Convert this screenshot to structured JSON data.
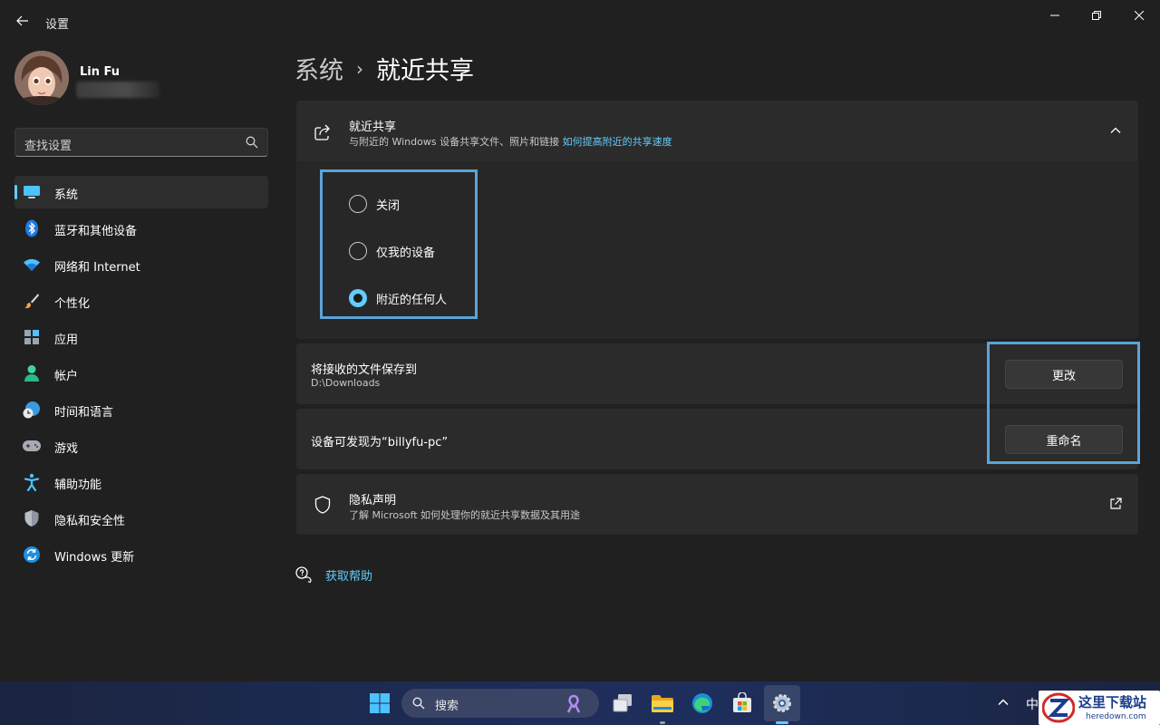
{
  "window": {
    "title": "设置"
  },
  "profile": {
    "name": "Lin Fu"
  },
  "search": {
    "placeholder": "查找设置"
  },
  "sidebar": {
    "items": [
      {
        "label": "系统",
        "icon": "monitor-icon",
        "active": true
      },
      {
        "label": "蓝牙和其他设备",
        "icon": "bluetooth-icon"
      },
      {
        "label": "网络和 Internet",
        "icon": "wifi-icon"
      },
      {
        "label": "个性化",
        "icon": "brush-icon"
      },
      {
        "label": "应用",
        "icon": "apps-icon"
      },
      {
        "label": "帐户",
        "icon": "person-icon"
      },
      {
        "label": "时间和语言",
        "icon": "globe-clock-icon"
      },
      {
        "label": "游戏",
        "icon": "gamepad-icon"
      },
      {
        "label": "辅助功能",
        "icon": "accessibility-icon"
      },
      {
        "label": "隐私和安全性",
        "icon": "shield-icon"
      },
      {
        "label": "Windows 更新",
        "icon": "update-icon"
      }
    ]
  },
  "breadcrumb": {
    "parent": "系统",
    "separator": "›",
    "current": "就近共享"
  },
  "nearby_sharing": {
    "title": "就近共享",
    "subtitle": "与附近的 Windows 设备共享文件、照片和链接",
    "link": "如何提高附近的共享速度",
    "options": [
      {
        "label": "关闭",
        "checked": false
      },
      {
        "label": "仅我的设备",
        "checked": false
      },
      {
        "label": "附近的任何人",
        "checked": true
      }
    ]
  },
  "save_location": {
    "title": "将接收的文件保存到",
    "path": "D:\\Downloads",
    "button": "更改"
  },
  "discoverable": {
    "title": "设备可发现为“billyfu-pc”",
    "button": "重命名"
  },
  "privacy": {
    "title": "隐私声明",
    "subtitle": "了解 Microsoft 如何处理你的就近共享数据及其用途"
  },
  "help": {
    "label": "获取帮助"
  },
  "taskbar": {
    "search_label": "搜索",
    "ime": "中"
  },
  "watermark": {
    "text": "这里下载站",
    "sub": "heredown.com"
  },
  "colors": {
    "accent": "#60cdff",
    "highlight_box": "#5ba4d8",
    "background": "#202020",
    "card": "#2b2b2b"
  }
}
